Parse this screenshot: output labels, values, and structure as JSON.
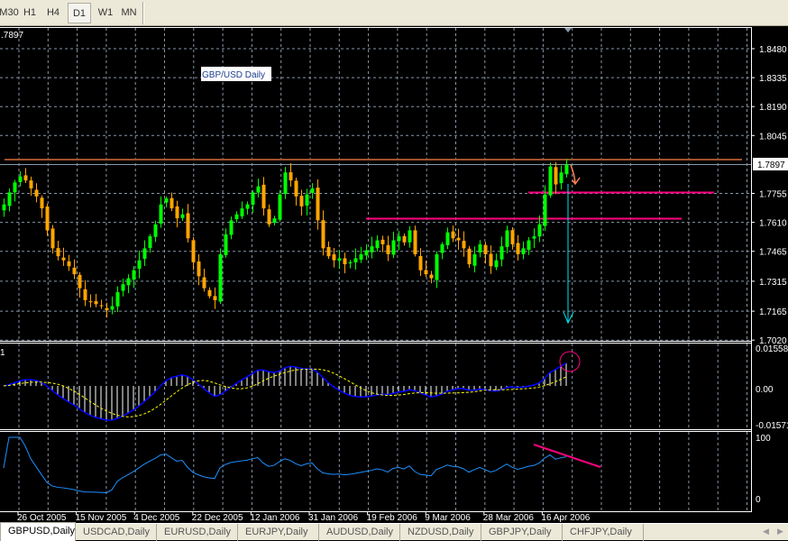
{
  "toolbar": {
    "timeframes": [
      {
        "label": "M30",
        "shown": "30"
      },
      {
        "label": "H1"
      },
      {
        "label": "H4"
      },
      {
        "label": "D1",
        "active": true
      },
      {
        "label": "W1"
      },
      {
        "label": "MN"
      }
    ]
  },
  "chart": {
    "symbol_label": "GBP/USD Daily",
    "top_left_price": ".7897",
    "current_price": "1.7897",
    "price_axis": [
      "1.8480",
      "1.8335",
      "1.8190",
      "1.8045",
      "1.7755",
      "1.7610",
      "1.7465",
      "1.7315",
      "1.7165",
      "1.7020"
    ],
    "macd_label": "1",
    "macd_axis": [
      "0.01558",
      "0.00",
      "-0.01571"
    ],
    "rsi_axis": [
      "100",
      "0"
    ],
    "dates": [
      "26 Oct 2005",
      "15 Nov 2005",
      "4 Dec 2005",
      "22 Dec 2005",
      "12 Jan 2006",
      "31 Jan 2006",
      "19 Feb 2006",
      "9 Mar 2006",
      "28 Mar 2006",
      "16 Apr 2006"
    ],
    "colors": {
      "bull": "#00ff00",
      "bear": "#ffa500",
      "grid": "#8796a8",
      "resistance": "#a0522d",
      "support": "#ff0080",
      "target_arrow": "#00e5ee",
      "macd": "#0000ff",
      "signal": "#ffff00",
      "rsi": "#1e90ff"
    }
  },
  "chart_data": {
    "type": "candlestick",
    "instrument": "GBPUSD",
    "timeframe": "Daily",
    "closes": [
      1.77,
      1.776,
      1.781,
      1.784,
      1.782,
      1.778,
      1.774,
      1.768,
      1.757,
      1.748,
      1.744,
      1.742,
      1.739,
      1.735,
      1.728,
      1.722,
      1.721,
      1.72,
      1.719,
      1.717,
      1.719,
      1.726,
      1.73,
      1.733,
      1.737,
      1.742,
      1.748,
      1.754,
      1.76,
      1.77,
      1.773,
      1.768,
      1.763,
      1.765,
      1.753,
      1.741,
      1.734,
      1.728,
      1.724,
      1.722,
      1.745,
      1.755,
      1.762,
      1.765,
      1.768,
      1.77,
      1.776,
      1.779,
      1.768,
      1.76,
      1.763,
      1.775,
      1.786,
      1.782,
      1.774,
      1.769,
      1.775,
      1.778,
      1.762,
      1.748,
      1.744,
      1.742,
      1.743,
      1.74,
      1.741,
      1.743,
      1.745,
      1.747,
      1.749,
      1.752,
      1.75,
      1.745,
      1.752,
      1.754,
      1.751,
      1.757,
      1.745,
      1.737,
      1.735,
      1.733,
      1.745,
      1.75,
      1.756,
      1.753,
      1.752,
      1.748,
      1.74,
      1.745,
      1.75,
      1.745,
      1.739,
      1.742,
      1.749,
      1.757,
      1.75,
      1.745,
      1.748,
      1.752,
      1.754,
      1.76,
      1.775,
      1.789,
      1.78,
      1.786,
      1.79
    ],
    "ylim": [
      1.702,
      1.848
    ],
    "horizontal_lines": [
      1.7915,
      1.7755,
      1.762
    ],
    "grid": true
  },
  "tabs": [
    {
      "label": "GBPUSD,Daily",
      "active": true
    },
    {
      "label": "USDCAD,Daily"
    },
    {
      "label": "EURUSD,Daily"
    },
    {
      "label": "EURJPY,Daily"
    },
    {
      "label": "AUDUSD,Daily"
    },
    {
      "label": "NZDUSD,Daily"
    },
    {
      "label": "GBPJPY,Daily"
    },
    {
      "label": "CHFJPY,Daily"
    }
  ]
}
